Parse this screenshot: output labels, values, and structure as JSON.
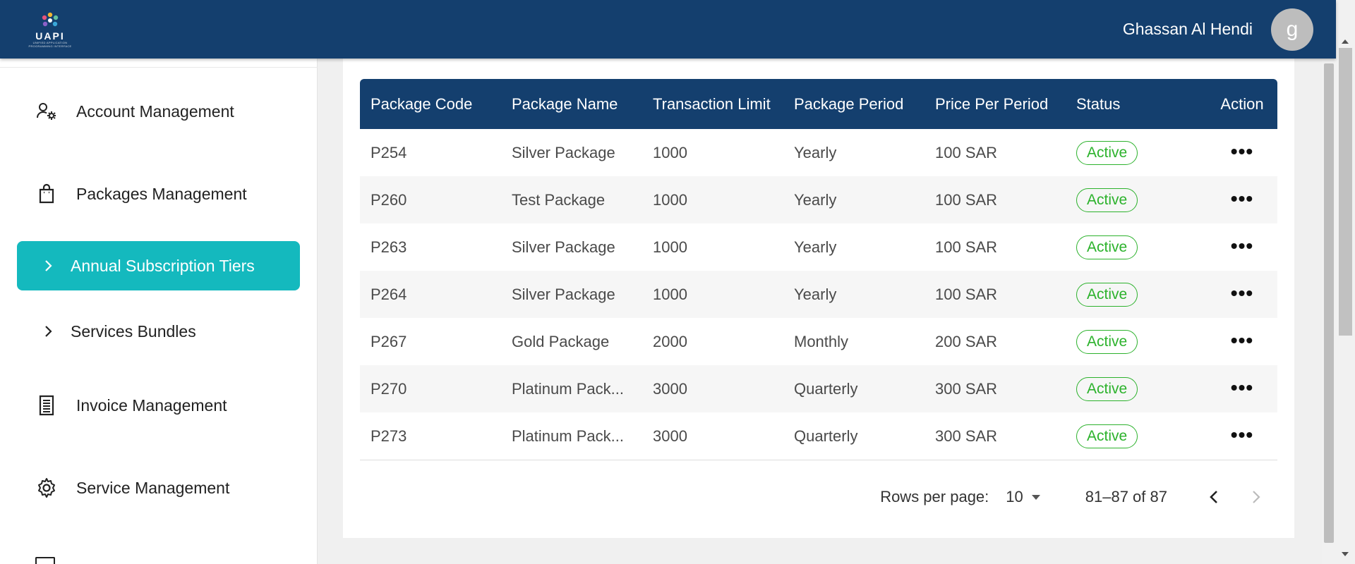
{
  "header": {
    "logo_text": "UAPI",
    "logo_subtext": "UNIFIED APPLICATION PROGRAMMING INTERFACE",
    "user_name": "Ghassan Al Hendi",
    "avatar_letter": "g"
  },
  "sidebar": {
    "items": [
      {
        "label": "Account Management",
        "icon": "user-gear-icon"
      },
      {
        "label": "Packages Management",
        "icon": "shopping-bag-icon"
      },
      {
        "label": "Annual Subscription Tiers",
        "icon": "chevron-right-icon",
        "active": true
      },
      {
        "label": "Services Bundles",
        "icon": "chevron-right-icon"
      },
      {
        "label": "Invoice Management",
        "icon": "receipt-icon"
      },
      {
        "label": "Service Management",
        "icon": "gear-icon"
      }
    ]
  },
  "table": {
    "headers": [
      "Package Code",
      "Package Name",
      "Transaction Limit",
      "Package Period",
      "Price Per Period",
      "Status",
      "Action"
    ],
    "rows": [
      {
        "code": "P254",
        "name": "Silver Package",
        "limit": "1000",
        "period": "Yearly",
        "price": "100 SAR",
        "status": "Active",
        "action": "•••"
      },
      {
        "code": "P260",
        "name": "Test Package",
        "limit": "1000",
        "period": "Yearly",
        "price": "100 SAR",
        "status": "Active",
        "action": "•••"
      },
      {
        "code": "P263",
        "name": "Silver Package",
        "limit": "1000",
        "period": "Yearly",
        "price": "100 SAR",
        "status": "Active",
        "action": "•••"
      },
      {
        "code": "P264",
        "name": "Silver Package",
        "limit": "1000",
        "period": "Yearly",
        "price": "100 SAR",
        "status": "Active",
        "action": "•••"
      },
      {
        "code": "P267",
        "name": "Gold Package",
        "limit": "2000",
        "period": "Monthly",
        "price": "200 SAR",
        "status": "Active",
        "action": "•••"
      },
      {
        "code": "P270",
        "name": "Platinum Pack...",
        "limit": "3000",
        "period": "Quarterly",
        "price": "300 SAR",
        "status": "Active",
        "action": "•••"
      },
      {
        "code": "P273",
        "name": "Platinum Pack...",
        "limit": "3000",
        "period": "Quarterly",
        "price": "300 SAR",
        "status": "Active",
        "action": "•••"
      }
    ]
  },
  "pagination": {
    "rows_per_page_label": "Rows per page:",
    "rows_per_page_value": "10",
    "range": "81–87 of 87",
    "prev": "‹",
    "next": "›"
  },
  "colors": {
    "header_bg": "#143f6e",
    "active_nav_bg": "#14b9be",
    "status_active": "#2cb22c"
  }
}
